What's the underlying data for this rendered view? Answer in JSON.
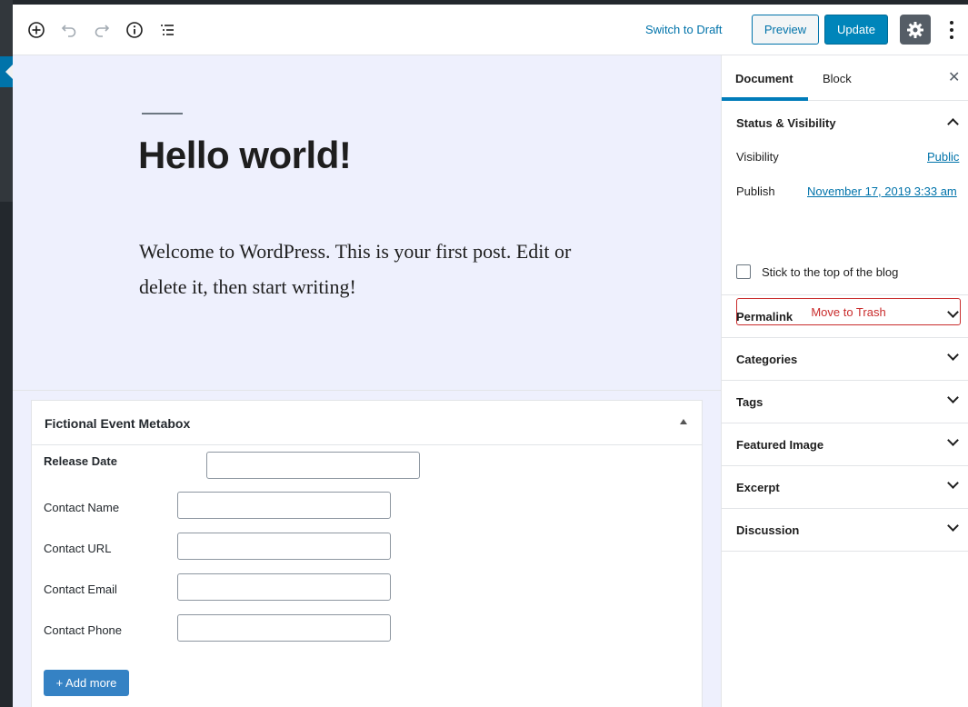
{
  "toolbar": {
    "icons": [
      "add-block-icon",
      "undo-icon",
      "redo-icon",
      "info-icon",
      "outline-icon"
    ],
    "switch_to_draft": "Switch to Draft",
    "preview": "Preview",
    "update": "Update"
  },
  "editor": {
    "title": "Hello world!",
    "body": "Welcome to WordPress. This is your first post. Edit or delete it, then start writing!"
  },
  "metabox": {
    "title": "Fictional Event Metabox",
    "fields": {
      "release_date": {
        "label": "Release Date",
        "value": ""
      },
      "contact_name": {
        "label": "Contact Name",
        "value": ""
      },
      "contact_url": {
        "label": "Contact URL",
        "value": ""
      },
      "contact_email": {
        "label": "Contact Email",
        "value": ""
      },
      "contact_phone": {
        "label": "Contact Phone",
        "value": ""
      }
    },
    "add_more": "+ Add more"
  },
  "sidebar": {
    "tabs": {
      "document": "Document",
      "block": "Block"
    },
    "close": "✕",
    "status": {
      "title": "Status & Visibility",
      "visibility_label": "Visibility",
      "visibility_value": "Public",
      "publish_label": "Publish",
      "publish_value": "November 17, 2019 3:33 am",
      "sticky_label": "Stick to the top of the blog",
      "sticky_checked": false,
      "trash": "Move to Trash"
    },
    "panels": {
      "permalink": "Permalink",
      "categories": "Categories",
      "tags": "Tags",
      "featured_image": "Featured Image",
      "excerpt": "Excerpt",
      "discussion": "Discussion"
    }
  },
  "colors": {
    "accent": "#0073aa",
    "update_button": "#0085ba",
    "editor_bg": "#eef0fd",
    "trash": "#c92c2c"
  }
}
